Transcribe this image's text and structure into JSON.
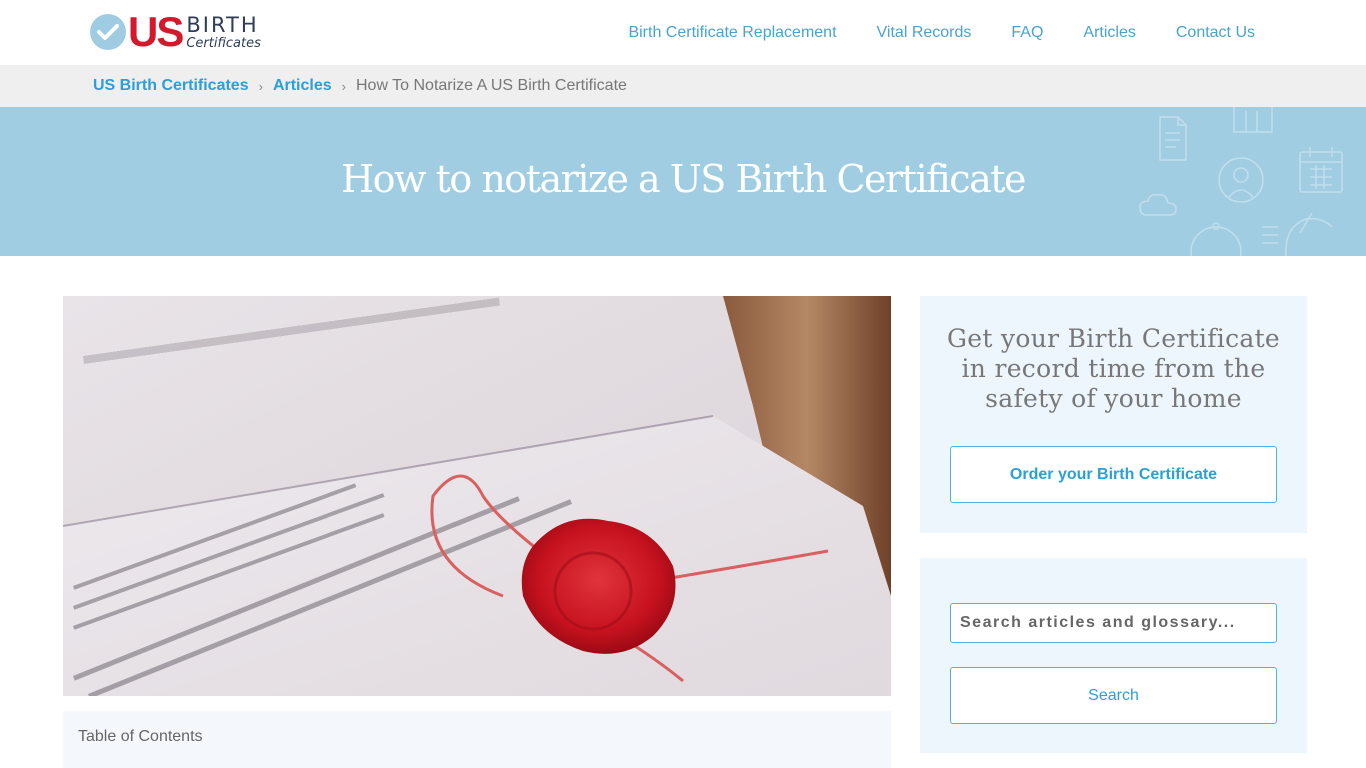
{
  "header": {
    "logo": {
      "primary": "US",
      "secondary": "BIRTH",
      "tagline": "Certificates",
      "check_icon": "check-circle-icon",
      "colors": {
        "check": "#9fcbe3",
        "us": "#d3192b",
        "text": "#2f3e55"
      }
    },
    "nav": [
      {
        "label": "Birth Certificate Replacement"
      },
      {
        "label": "Vital Records"
      },
      {
        "label": "FAQ"
      },
      {
        "label": "Articles"
      },
      {
        "label": "Contact Us"
      }
    ]
  },
  "breadcrumb": {
    "items": [
      {
        "label": "US Birth Certificates"
      },
      {
        "label": "Articles"
      }
    ],
    "separator": "›",
    "current": "How To Notarize A US Birth Certificate"
  },
  "hero": {
    "title": "How to notarize a US Birth Certificate",
    "background": "#a0cde2",
    "decorative_icons": [
      "document-icon",
      "book-icon",
      "user-circle-icon",
      "calendar-icon",
      "cloud-icon",
      "stopwatch-icon",
      "globe-icon"
    ]
  },
  "article": {
    "image_alt": "Document with red wax seal and twine",
    "toc_label": "Table of Contents"
  },
  "sidebar": {
    "promo": {
      "text": "Get your Birth Certificate in record time from the safety of your home",
      "button_label": "Order your Birth Certificate"
    },
    "search": {
      "placeholder": "Search articles and glossary...",
      "value": "",
      "button_label": "Search"
    }
  },
  "colors": {
    "accent": "#2ba0d8",
    "nav_link": "#4aa3cf",
    "breadcrumb_bg": "#efefef",
    "sidebar_bg": "#eef6fd"
  }
}
